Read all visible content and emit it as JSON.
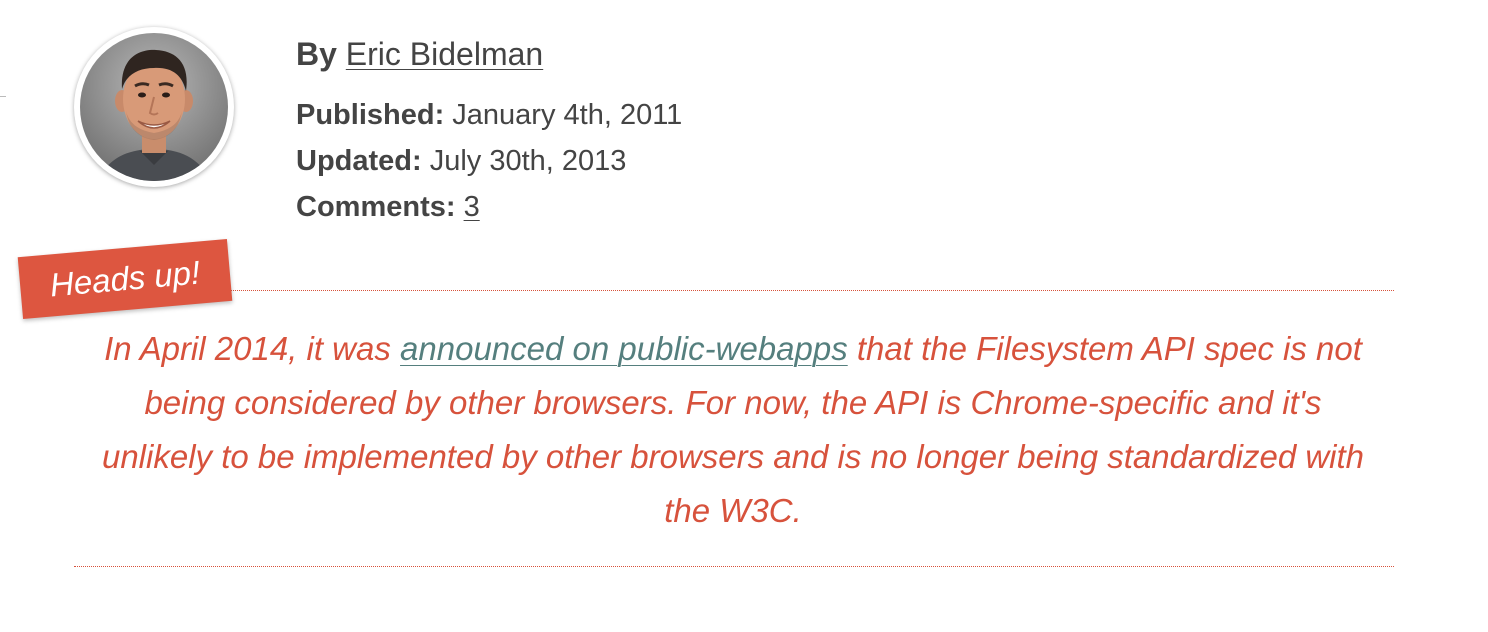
{
  "author": {
    "by_label": "By",
    "name": "Eric Bidelman",
    "avatar_icon": "author-photo"
  },
  "meta": {
    "published_label": "Published:",
    "published_value": "January 4th, 2011",
    "updated_label": "Updated:",
    "updated_value": "July 30th, 2013",
    "comments_label": "Comments:",
    "comments_count": "3"
  },
  "notice": {
    "badge": "Heads up!",
    "text_before": "In April 2014, it was ",
    "link_text": "announced on public-webapps",
    "text_after": " that the Filesystem API spec is not being considered by other browsers. For now, the API is Chrome-specific and it's unlikely to be implemented by other browsers and is no longer being standardized with the W3C."
  },
  "colors": {
    "accent": "#dd5640",
    "notice_text": "#d7523c",
    "notice_link": "#557f7e",
    "meta_text": "#444444"
  }
}
